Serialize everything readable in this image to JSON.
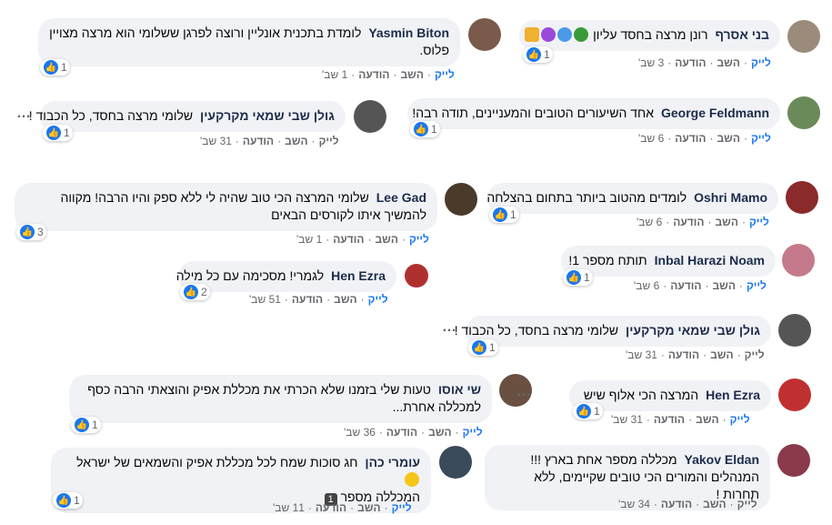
{
  "comments": [
    {
      "author": "בני אסרף",
      "text": "רונן מרצה בחסד עליון",
      "emojis": [
        "thumbs-up",
        "purple-heart",
        "blue-heart",
        "green-heart"
      ],
      "reactions": "1",
      "like": "לייק",
      "reply": "השב",
      "more": "הודעה",
      "time": "3 שב'",
      "avatar_color": "#9a8b7a"
    },
    {
      "author": "Yasmin Biton",
      "text": "לומדת בתכנית אונליין ורוצה לפרגן ששלומי הוא מרצה מצויין פלוס.",
      "reactions": "1",
      "like": "לייק",
      "reply": "השב",
      "more": "הודעה",
      "time": "1 שב'",
      "avatar_color": "#7a5a4a"
    },
    {
      "author": "George Feldmann",
      "text": "אחד השיעורים הטובים והמעניינים, תודה רבה!",
      "reactions": "1",
      "like": "לייק",
      "reply": "השב",
      "more": "הודעה",
      "time": "6 שב'",
      "avatar_color": "#6a8a5a"
    },
    {
      "author": "גולן שבי שמאי מקרקעין",
      "text": "שלומי מרצה בחסד, כל הכבוד !",
      "reactions": "1",
      "like": "לייק",
      "reply": "השב",
      "more": "הודעה",
      "time": "31 שב'",
      "avatar_color": "#555555"
    },
    {
      "author": "Oshri Mamo",
      "text": "לומדים מהטוב ביותר בתחום בהצלחה",
      "reactions": "1",
      "like": "לייק",
      "reply": "השב",
      "more": "הודעה",
      "time": "6 שב'",
      "avatar_color": "#8a2a2a"
    },
    {
      "author": "Lee Gad",
      "text": "שלומי המרצה הכי טוב שהיה לי ללא ספק והיו הרבה! מקווה להמשיך איתו לקורסים הבאים",
      "reactions": "3",
      "like": "לייק",
      "reply": "השב",
      "more": "הודעה",
      "time": "1 שב'",
      "avatar_color": "#4a3a2a"
    },
    {
      "author": "Inbal Harazi Noam",
      "text": "תותח מספר 1!",
      "reactions": "1",
      "like": "לייק",
      "reply": "השב",
      "more": "הודעה",
      "time": "6 שב'",
      "avatar_color": "#c47a8a"
    },
    {
      "author": "Hen Ezra",
      "text": "לגמרי! מסכימה עם כל מילה",
      "reactions": "2",
      "like": "לייק",
      "reply": "השב",
      "more": "הודעה",
      "time": "51 שב'",
      "avatar_color": "#b03030"
    },
    {
      "author": "גולן שבי שמאי מקרקעין",
      "text": "שלומי מרצה בחסד, כל הכבוד !",
      "reactions": "1",
      "like": "לייק",
      "reply": "השב",
      "more": "הודעה",
      "time": "31 שב'",
      "avatar_color": "#555555"
    },
    {
      "author": "שי אוסו",
      "text": "טעות שלי בזמנו שלא הכרתי את מכללת אפיק והוצאתי הרבה כסף למכללה אחרת...",
      "reactions": "1",
      "like": "לייק",
      "reply": "השב",
      "more": "הודעה",
      "time": "36 שב'",
      "avatar_color": "#6a5040"
    },
    {
      "author": "Hen Ezra",
      "text": "המרצה הכי אלוף שיש",
      "reactions": "1",
      "like": "לייק",
      "reply": "השב",
      "more": "הודעה",
      "time": "31 שב'",
      "avatar_color": "#c03030"
    },
    {
      "author": "Yakov Eldan",
      "text": "מכללה מספר אחת בארץ !!! המנהלים והמורים הכי טובים שקיימים, ללא תחרות !",
      "reactions": "",
      "like": "לייק",
      "reply": "השב",
      "more": "הודעה",
      "time": "34 שב'",
      "avatar_color": "#8a3a4a"
    },
    {
      "author": "עומרי כהן",
      "text": "חג סוכות שמח לכל מכללת אפיק והשמאים של ישראל",
      "text2": "המכללה מספר",
      "badge": "1",
      "reactions": "1",
      "like": "לייק",
      "reply": "השב",
      "more": "הודעה",
      "time": "11 שב'",
      "avatar_color": "#3a4a5a"
    }
  ],
  "more_icon": "…"
}
